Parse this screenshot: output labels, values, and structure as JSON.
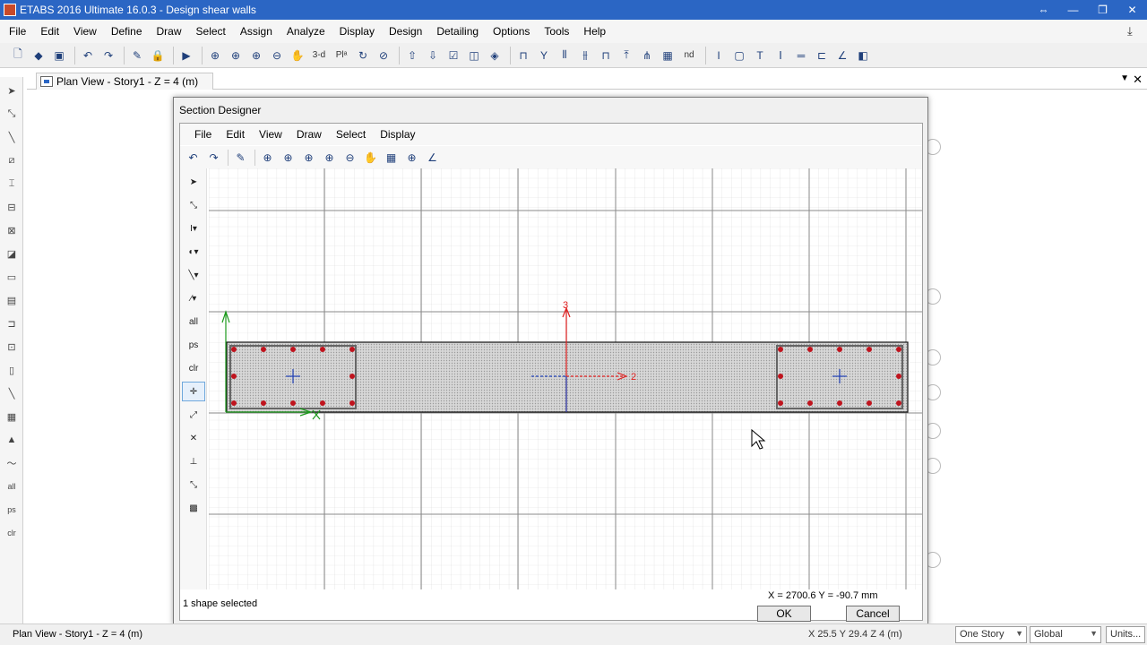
{
  "app": {
    "title": "ETABS 2016 Ultimate 16.0.3 - Design shear walls"
  },
  "main_menu": [
    "File",
    "Edit",
    "View",
    "Define",
    "Draw",
    "Select",
    "Assign",
    "Analyze",
    "Display",
    "Design",
    "Detailing",
    "Options",
    "Tools",
    "Help"
  ],
  "toolbar": {
    "view_3d": "3-d",
    "plan": "Plᵃ",
    "nd": "nd"
  },
  "left_toolbar": {
    "all": "all",
    "ps": "ps",
    "clr": "clr"
  },
  "tab": {
    "label": "Plan View - Story1 - Z = 4 (m)"
  },
  "dialog": {
    "title": "Section Designer",
    "menu": [
      "File",
      "Edit",
      "View",
      "Draw",
      "Select",
      "Display"
    ],
    "tools": {
      "all": "all",
      "ps": "ps",
      "clr": "clr"
    },
    "axes": {
      "axis_3": "3",
      "axis_2": "2"
    },
    "status": "1 shape selected",
    "coords": "X = 2700.6    Y = -90.7 mm",
    "ok_label": "OK",
    "cancel_label": "Cancel"
  },
  "statusbar": {
    "left_text": "Plan View - Story1 - Z = 4 (m)",
    "coords": "X 25.5  Y 29.4  Z 4 (m)",
    "story_combo": "One Story",
    "coord_combo": "Global",
    "units_button": "Units..."
  },
  "colors": {
    "titlebar": "#2b66c4",
    "rebar": "#c0141e",
    "axis_red": "#e02020",
    "axis_green": "#1c9a1c",
    "centroid": "#1f3fb4"
  }
}
